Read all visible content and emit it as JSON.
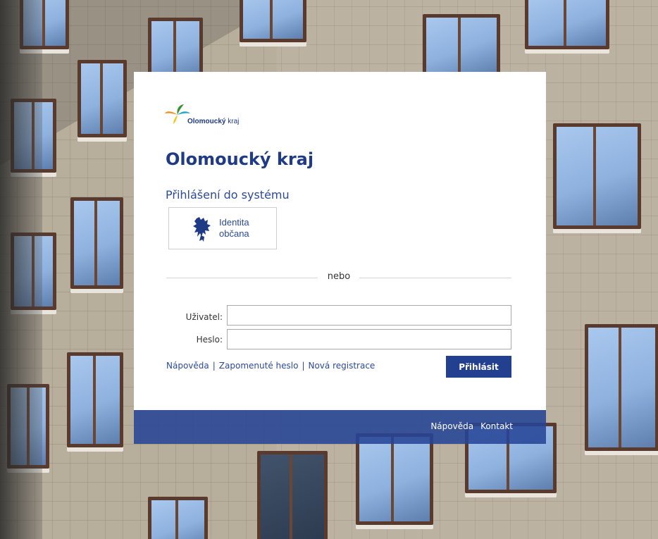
{
  "logo": {
    "name_bold": "Olomoucký",
    "name_light": "kraj"
  },
  "page": {
    "title": "Olomoucký kraj",
    "subtitle": "Přihlášení do systému"
  },
  "identity_button": {
    "label_line1": "Identita",
    "label_line2": "občana"
  },
  "divider": {
    "text": "nebo"
  },
  "form": {
    "user_label": "Uživatel:",
    "user_value": "",
    "password_label": "Heslo:",
    "password_value": ""
  },
  "links": {
    "help": "Nápověda",
    "forgot_password": "Zapomenuté heslo",
    "new_registration": "Nová registrace",
    "separator": "|"
  },
  "login_button": {
    "label": "Přihlásit"
  },
  "footer": {
    "help": "Nápověda",
    "contact": "Kontakt"
  },
  "colors": {
    "brand_blue": "#1f3b86",
    "button_blue": "#233f8f",
    "footer_blue": "#254496",
    "logo_green": "#3a8f2f",
    "logo_orange": "#f28c1e",
    "logo_yellow": "#f3c416",
    "logo_cyan": "#21a6c9"
  },
  "icons": {
    "logo": "olomoucky-kraj-logo",
    "identity": "lion-emblem-icon"
  }
}
